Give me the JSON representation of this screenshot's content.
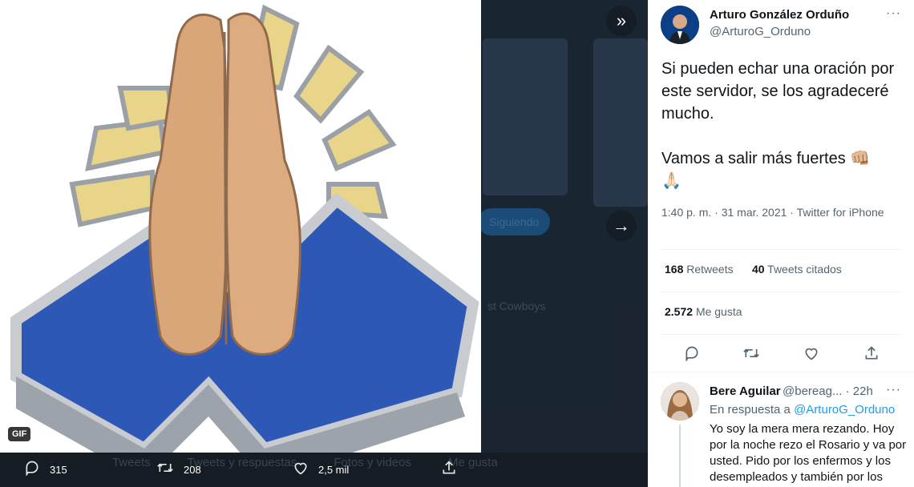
{
  "media": {
    "gif_badge": "GIF",
    "collapse_icon": "double-chevron-right-icon",
    "next_icon": "arrow-right-icon",
    "actions": {
      "replies": "315",
      "retweets": "208",
      "likes": "2,5 mil"
    }
  },
  "tweet": {
    "author_name": "Arturo González Orduño",
    "author_handle": "@ArturoG_Orduno",
    "paragraph_1": "Si pueden echar una oración por este servidor, se los agradeceré mucho.",
    "paragraph_2": "Vamos a salir más fuertes",
    "emoji_fist": "👊🏼",
    "emoji_pray": "🙏🏻",
    "meta": "1:40 p. m. · 31 mar. 2021 · Twitter for iPhone",
    "retweets_count": "168",
    "retweets_label": "Retweets",
    "quotes_count": "40",
    "quotes_label": "Tweets citados",
    "likes_count": "2.572",
    "likes_label": "Me gusta"
  },
  "reply": {
    "name": "Bere Aguilar",
    "handle_time": "@bereag... · 22h",
    "context_prefix": "En respuesta a",
    "context_handle": "@ArturoG_Orduno",
    "text": "Yo soy la mera mera rezando. Hoy por la noche rezo el Rosario y va por usted. Pido  por los enfermos y los desempleados y también por los"
  },
  "colors": {
    "accent": "#1d9bf0",
    "text_primary": "#0f1419",
    "text_secondary": "#536471",
    "viewer_bg": "#161c24"
  }
}
